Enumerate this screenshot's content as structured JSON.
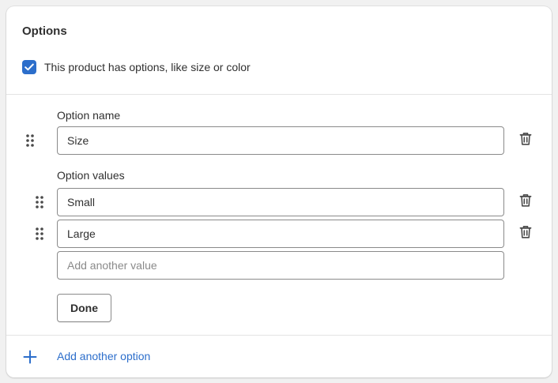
{
  "card": {
    "title": "Options",
    "has_options_label": "This product has options, like size or color",
    "has_options_checked": true
  },
  "option": {
    "name_label": "Option name",
    "name_value": "Size",
    "values_label": "Option values",
    "values": [
      "Small",
      "Large"
    ],
    "add_value_placeholder": "Add another value",
    "done_label": "Done"
  },
  "footer": {
    "add_option_label": "Add another option"
  },
  "colors": {
    "accent": "#2c6ecb",
    "border": "#8a8a8a",
    "divider": "#e3e3e3",
    "text": "#303030"
  },
  "icons": [
    "checkmark-icon",
    "drag-handle-icon",
    "trash-icon",
    "plus-icon"
  ]
}
